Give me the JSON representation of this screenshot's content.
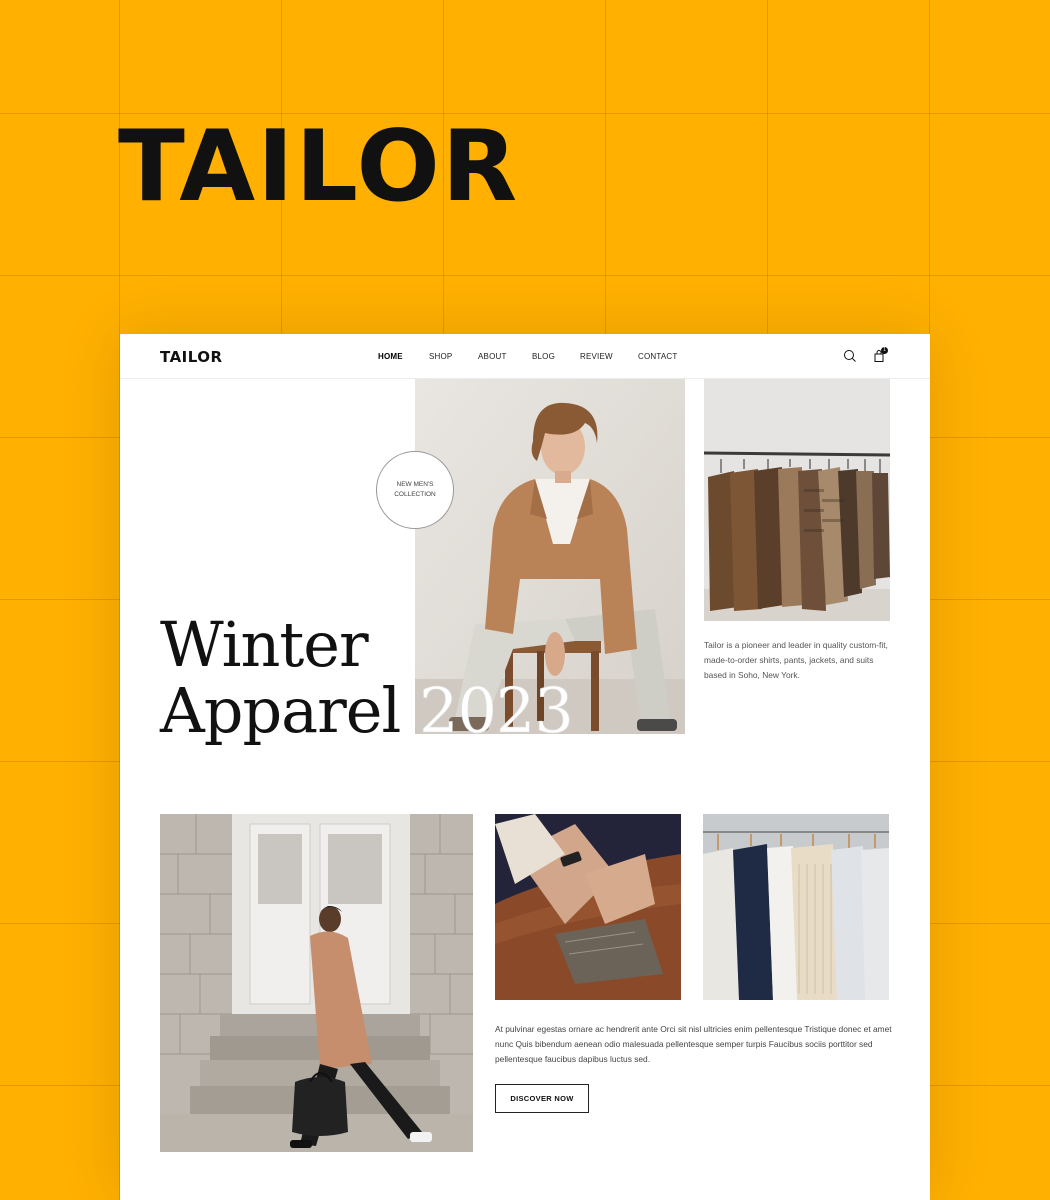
{
  "brand": {
    "logo_text": "TAILOR"
  },
  "navbar": {
    "logo": "TAILOR",
    "links": [
      {
        "label": "HOME",
        "active": true
      },
      {
        "label": "SHOP",
        "active": false
      },
      {
        "label": "ABOUT",
        "active": false
      },
      {
        "label": "BLOG",
        "active": false
      },
      {
        "label": "REVIEW",
        "active": false
      },
      {
        "label": "CONTACT",
        "active": false
      }
    ],
    "search_icon": "search-icon",
    "cart_icon": "shopping-bag-icon",
    "cart_count": "1"
  },
  "hero": {
    "badge_line1": "NEW MEN'S",
    "badge_line2": "COLLECTION",
    "title_line1": "Winter",
    "title_line2": "Apparel",
    "title_year": "2023",
    "about_text": "Tailor is a pioneer and leader in quality custom-fit, made-to-order shirts, pants, jackets, and suits based in Soho, New York."
  },
  "lower": {
    "description": "At pulvinar egestas ornare ac hendrerit ante Orci sit nisl ultricies enim pellentesque Tristique donec et amet nunc Quis bibendum aenean odio malesuada pellentesque semper turpis Faucibus sociis porttitor sed pellentesque faucibus dapibus luctus sed.",
    "cta_label": "DISCOVER NOW"
  },
  "colors": {
    "background": "#FFB000",
    "page": "#FFFFFF",
    "text": "#111111"
  }
}
